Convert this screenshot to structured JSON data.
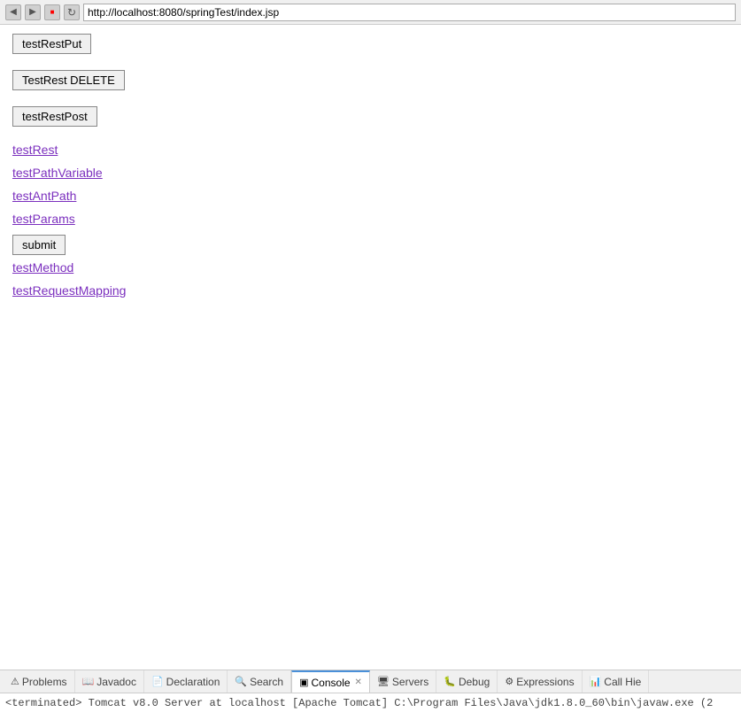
{
  "browser": {
    "url": "http://localhost:8080/springTest/index.jsp"
  },
  "page": {
    "buttons": [
      {
        "id": "testRestPut",
        "label": "testRestPut"
      },
      {
        "id": "testRestDelete",
        "label": "TestRest DELETE"
      },
      {
        "id": "testRestPost",
        "label": "testRestPost"
      },
      {
        "id": "submit",
        "label": "submit"
      }
    ],
    "links": [
      {
        "id": "testRest",
        "label": "testRest"
      },
      {
        "id": "testPathVariable",
        "label": "testPathVariable"
      },
      {
        "id": "testAntPath",
        "label": "testAntPath"
      },
      {
        "id": "testParams",
        "label": "testParams"
      },
      {
        "id": "testMethod",
        "label": "testMethod"
      },
      {
        "id": "testRequestMapping",
        "label": "testRequestMapping"
      }
    ]
  },
  "bottom_panel": {
    "tabs": [
      {
        "id": "problems",
        "label": "Problems",
        "icon": "⚠",
        "active": false
      },
      {
        "id": "javadoc",
        "label": "Javadoc",
        "icon": "J",
        "active": false
      },
      {
        "id": "declaration",
        "label": "Declaration",
        "icon": "📄",
        "active": false
      },
      {
        "id": "search",
        "label": "Search",
        "icon": "🔍",
        "active": false
      },
      {
        "id": "console",
        "label": "Console",
        "icon": "▣",
        "active": true,
        "closable": true
      },
      {
        "id": "servers",
        "label": "Servers",
        "icon": "🖥",
        "active": false
      },
      {
        "id": "debug",
        "label": "Debug",
        "icon": "🐛",
        "active": false
      },
      {
        "id": "expressions",
        "label": "Expressions",
        "icon": "⚙",
        "active": false
      },
      {
        "id": "callhie",
        "label": "Call Hie",
        "icon": "📊",
        "active": false
      }
    ],
    "console": {
      "terminated_text": "<terminated> Tomcat v8.0 Server at localhost [Apache Tomcat] C:\\Program Files\\Java\\jdk1.8.0_60\\bin\\javaw.exe (2"
    }
  }
}
